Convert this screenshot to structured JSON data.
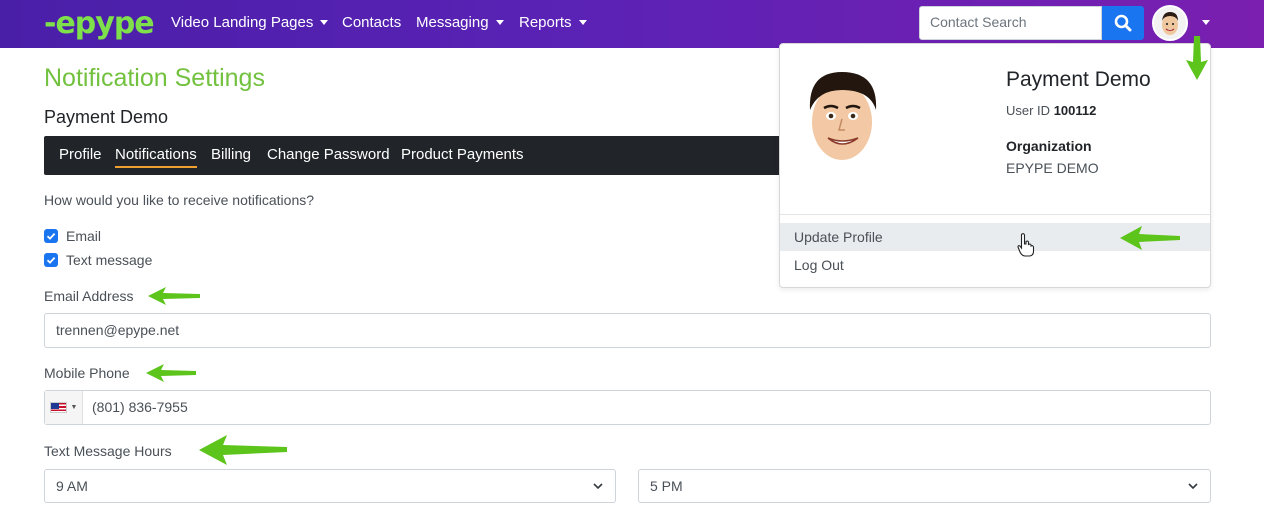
{
  "app": {
    "logo_text": "-epype"
  },
  "nav": {
    "items": [
      {
        "label": "Video Landing Pages",
        "has_caret": true
      },
      {
        "label": "Contacts",
        "has_caret": false
      },
      {
        "label": "Messaging",
        "has_caret": true
      },
      {
        "label": "Reports",
        "has_caret": true
      }
    ],
    "search_placeholder": "Contact Search",
    "search_icon": "search-icon",
    "avatar_icon": "avatar"
  },
  "page": {
    "title": "Notification Settings",
    "subtitle": "Payment Demo",
    "tabs": [
      {
        "label": "Profile",
        "active": false
      },
      {
        "label": "Notifications",
        "active": true
      },
      {
        "label": "Billing",
        "active": false
      },
      {
        "label": "Change Password",
        "active": false
      },
      {
        "label": "Product Payments",
        "active": false
      }
    ],
    "question": "How would you like to receive notifications?",
    "checkboxes": [
      {
        "label": "Email",
        "checked": true
      },
      {
        "label": "Text message",
        "checked": true
      }
    ],
    "email_label": "Email Address",
    "email_value": "trennen@epype.net",
    "phone_label": "Mobile Phone",
    "phone_value": "(801) 836-7955",
    "phone_country": "us-flag-icon",
    "hours_label": "Text Message Hours",
    "hours_start": "9 AM",
    "hours_end": "5 PM"
  },
  "dropdown": {
    "name": "Payment Demo",
    "user_id_label": "User ID",
    "user_id": "100112",
    "org_label": "Organization",
    "org_value": "EPYPE DEMO",
    "items": [
      {
        "label": "Update Profile",
        "hovered": true
      },
      {
        "label": "Log Out",
        "hovered": false
      }
    ]
  },
  "colors": {
    "navbar_start": "#4a1fa8",
    "navbar_end": "#7a1fb0",
    "logo_green": "#7ee04a",
    "title_green": "#72c13f",
    "tab_active_underline": "#f0a030",
    "primary_blue": "#1a75f0",
    "annotation_arrow": "#5cc41a"
  }
}
